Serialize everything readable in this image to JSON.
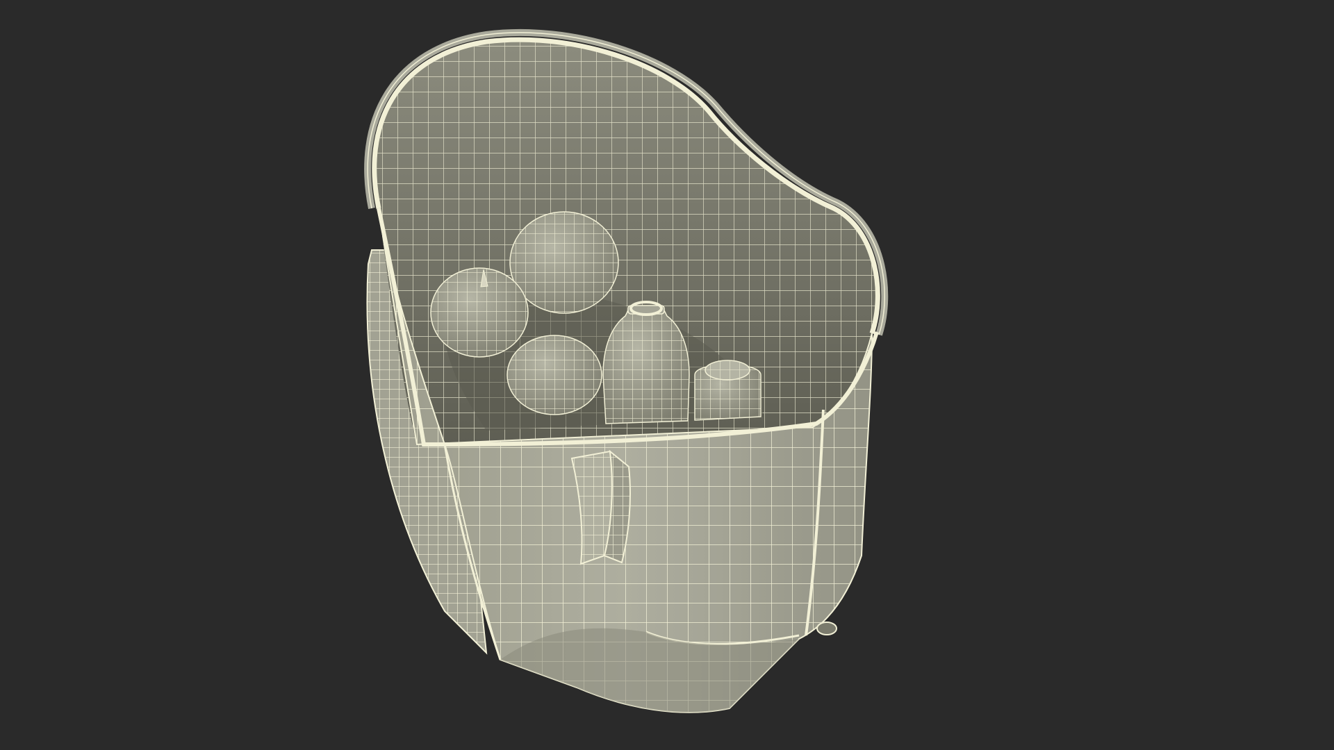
{
  "scene": {
    "subject": "wireframe-tote-bag-with-groceries",
    "render_style": "wireframe",
    "colors": {
      "background": "#2a2a2a",
      "surface": "#a8a898",
      "surface_dark": "#8e8e80",
      "interior": "#6f6f63",
      "wire": "#f2f0d6"
    },
    "objects": [
      "bag-body",
      "bag-handle-back",
      "bag-handle-front",
      "orange",
      "apple",
      "grapefruit",
      "bottle",
      "jar"
    ]
  }
}
